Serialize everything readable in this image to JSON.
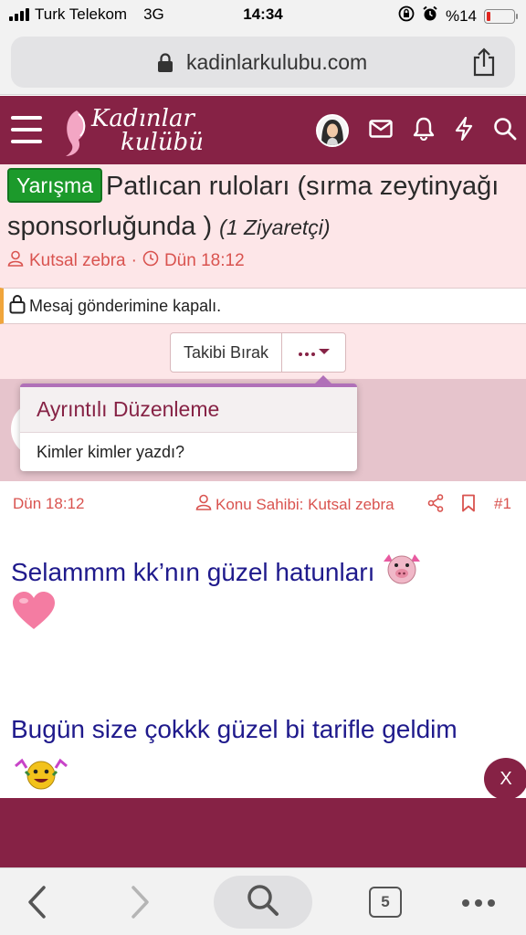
{
  "status_bar": {
    "carrier": "Turk Telekom",
    "network": "3G",
    "time": "14:34",
    "battery": "%14",
    "battery_level": 0.14
  },
  "browser": {
    "url": "kadinlarkulubu.com",
    "open_tabs": "5"
  },
  "site": {
    "logo_line1": "Kadınlar",
    "logo_line2": "kulübü",
    "brand_color": "#862245"
  },
  "thread": {
    "prefix": "Yarışma",
    "title": "Patlıcan ruloları (sırma zeytinyağı sponsorluğunda )",
    "visitors": "(1 Ziyaretçi)",
    "author": "Kutsal zebra",
    "separator": "·",
    "date": "Dün 18:12",
    "closed_notice": "Mesaj gönderimine kapalı.",
    "unfollow_label": "Takibi Bırak"
  },
  "dropdown": {
    "header": "Ayrıntılı Düzenleme",
    "item": "Kimler kimler yazdı?"
  },
  "post": {
    "date": "Dün 18:12",
    "owner": "Konu Sahibi: Kutsal zebra",
    "number": "#1",
    "line1": "Selammm kk’nın güzel hatunları",
    "line2": "Bugün size çokkk güzel bi tarifle geldim"
  },
  "overlay": {
    "close_label": "X"
  }
}
